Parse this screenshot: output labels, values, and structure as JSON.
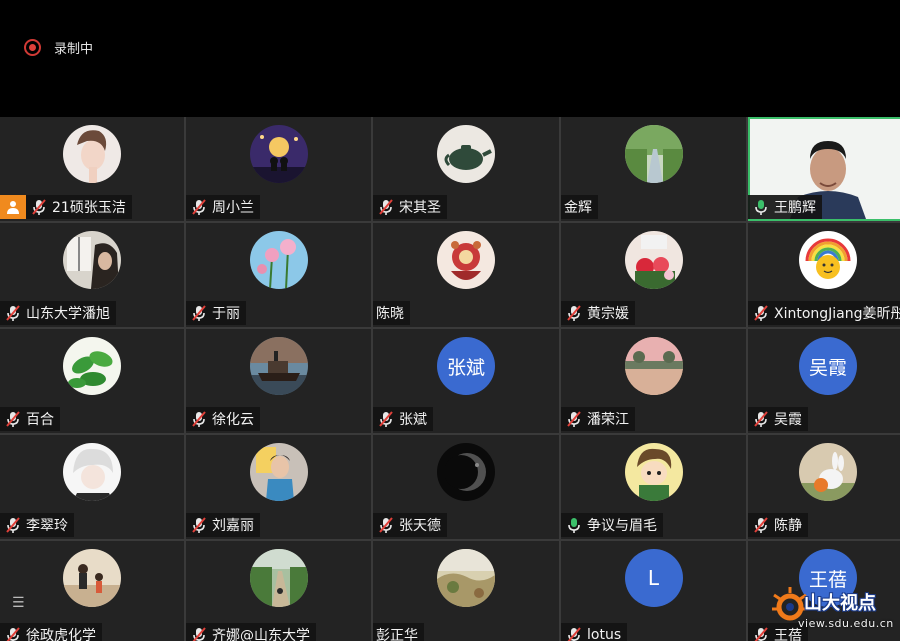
{
  "recording": {
    "label": "录制中"
  },
  "participants": [
    {
      "name": "21硕张玉洁",
      "mic": "muted",
      "avatar": "photo-woman",
      "host": true
    },
    {
      "name": "周小兰",
      "mic": "muted",
      "avatar": "photo-night-couple"
    },
    {
      "name": "宋其圣",
      "mic": "muted",
      "avatar": "photo-teapot"
    },
    {
      "name": "金辉",
      "mic": "none",
      "avatar": "photo-river-trees"
    },
    {
      "name": "王鹏辉",
      "mic": "active",
      "avatar": "video",
      "speaking": true
    },
    {
      "name": "山东大学潘旭",
      "mic": "muted",
      "avatar": "photo-window-girl"
    },
    {
      "name": "于丽",
      "mic": "muted",
      "avatar": "photo-pink-flowers"
    },
    {
      "name": "陈晓",
      "mic": "none",
      "avatar": "photo-red-art"
    },
    {
      "name": "黄宗媛",
      "mic": "muted",
      "avatar": "photo-flowers-lantern"
    },
    {
      "name": "XintongJiang姜昕彤",
      "mic": "muted",
      "avatar": "photo-rainbow-sun"
    },
    {
      "name": "百合",
      "mic": "muted",
      "avatar": "photo-green-leaves"
    },
    {
      "name": "徐化云",
      "mic": "muted",
      "avatar": "photo-ship"
    },
    {
      "name": "张斌",
      "mic": "muted",
      "avatar": "letter",
      "letter": "张斌"
    },
    {
      "name": "潘荣江",
      "mic": "muted",
      "avatar": "photo-lake-sunset"
    },
    {
      "name": "吴霞",
      "mic": "muted",
      "avatar": "letter",
      "letter": "吴霞"
    },
    {
      "name": "李翠玲",
      "mic": "muted",
      "avatar": "photo-anime-white"
    },
    {
      "name": "刘嘉丽",
      "mic": "muted",
      "avatar": "photo-woman-blue"
    },
    {
      "name": "张天德",
      "mic": "muted",
      "avatar": "photo-moon"
    },
    {
      "name": "争议与眉毛",
      "mic": "active",
      "avatar": "photo-cartoon-boy"
    },
    {
      "name": "陈静",
      "mic": "muted",
      "avatar": "photo-rabbit"
    },
    {
      "name": "徐政虎化学",
      "mic": "muted",
      "avatar": "photo-two-kids"
    },
    {
      "name": "齐娜@山东大学",
      "mic": "muted",
      "avatar": "photo-road-trees"
    },
    {
      "name": "彭正华",
      "mic": "none",
      "avatar": "photo-grass-field"
    },
    {
      "name": "lotus",
      "mic": "muted",
      "avatar": "letter",
      "letter": "L"
    },
    {
      "name": "王蓓",
      "mic": "muted",
      "avatar": "letter",
      "letter": "王蓓"
    }
  ],
  "watermark": {
    "title": "山大视点",
    "url": "view.sdu.edu.cn"
  },
  "colors": {
    "active_border": "#3bbf6a",
    "muted_slash": "#e0403a",
    "letter_avatar": "#3a6ad0",
    "host_badge": "#f08a1e"
  }
}
